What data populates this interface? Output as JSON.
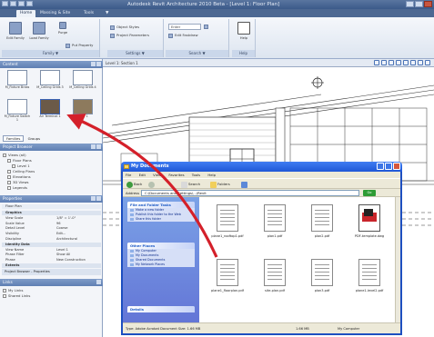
{
  "revit": {
    "title": "Autodesk Revit Architecture 2010 Beta - [Level 1: Floor Plan]",
    "tabs": [
      "Home",
      "Massing & Site",
      "Tools",
      "▼"
    ],
    "ribbon": {
      "panels": [
        {
          "label": "Family ▼",
          "buttons": [
            "Edit Family",
            "Load Family",
            "Purge"
          ],
          "small": [
            "Load Template",
            "Put Property"
          ]
        },
        {
          "label": "Settings ▼",
          "small": [
            "Object Styles",
            "Project Parameters"
          ]
        },
        {
          "label": "Search ▼",
          "input": "Enter",
          "small": [
            "Edit Fastdraw"
          ]
        },
        {
          "label": "Help",
          "buttons": [
            "Help"
          ]
        }
      ]
    },
    "library": {
      "header": "Content",
      "items": [
        {
          "label": "M_Fixture Brass",
          "selected": false
        },
        {
          "label": "M_Ceiling Grids 3",
          "selected": false
        },
        {
          "label": "M_Ceiling Grids 4",
          "selected": false
        },
        {
          "label": "M_Fixture Switch 1",
          "selected": false
        },
        {
          "label": "Air Terminal 1",
          "selected": true
        },
        {
          "label": "Floor 1",
          "selected": false
        }
      ],
      "tabs": [
        "Families",
        "Groups"
      ]
    },
    "browser": {
      "header": "Project Browser",
      "rows": [
        "Views (all)",
        "Floor Plans",
        "Level 1",
        "Ceiling Plans",
        "Elevations",
        "3D Views",
        "Legends"
      ]
    },
    "properties": {
      "header": "Properties",
      "subheader": "Floor Plan",
      "rows": [
        {
          "k": "Graphics",
          "v": "",
          "group": true
        },
        {
          "k": "View Scale",
          "v": "1/8\" = 1'-0\""
        },
        {
          "k": "Scale Value",
          "v": "96"
        },
        {
          "k": "Detail Level",
          "v": "Coarse"
        },
        {
          "k": "Visibility",
          "v": "Edit..."
        },
        {
          "k": "Discipline",
          "v": "Architectural"
        },
        {
          "k": "Identity Data",
          "v": "",
          "group": true
        },
        {
          "k": "View Name",
          "v": "Level 1"
        },
        {
          "k": "Phase Filter",
          "v": "Show All"
        },
        {
          "k": "Phase",
          "v": "New Construction"
        },
        {
          "k": "Extents",
          "v": "",
          "group": true
        }
      ],
      "footer": "Project Browser - Properties"
    },
    "bottom_panel": {
      "header": "Links",
      "rows": [
        "My Links",
        "Shared Links"
      ]
    },
    "canvas": {
      "tab": "Level 1: Section 1"
    }
  },
  "explorer": {
    "title": "My Documents",
    "menu": [
      "File",
      "Edit",
      "View",
      "Favorites",
      "Tools",
      "Help"
    ],
    "toolbar": [
      "Back",
      "Search",
      "Folders"
    ],
    "address_label": "Address",
    "address": "C:\\Documents and Settings\\...\\Revit",
    "go": "Go",
    "tasks": [
      {
        "header": "File and Folder Tasks",
        "items": [
          "Make a new folder",
          "Publish this folder to the Web",
          "Share this folder"
        ]
      },
      {
        "header": "Other Places",
        "items": [
          "My Computer",
          "My Documents",
          "Shared Documents",
          "My Network Places"
        ]
      },
      {
        "header": "Details",
        "items": []
      }
    ],
    "files": [
      {
        "name": "plane1_rooftop1.pdf",
        "kind": "doc"
      },
      {
        "name": "plan1.pdf",
        "kind": "doc"
      },
      {
        "name": "plan2.pdf",
        "kind": "doc"
      },
      {
        "name": "PDF-template.dwg",
        "kind": "red"
      },
      {
        "name": "plane1_floorplan.pdf",
        "kind": "doc"
      },
      {
        "name": "site-plan.pdf",
        "kind": "doc"
      },
      {
        "name": "plan3.pdf",
        "kind": "doc"
      },
      {
        "name": "plane1-level2.pdf",
        "kind": "doc"
      }
    ],
    "status": "Type: Adobe Acrobat Document Size: 1.66 MB",
    "status_size": "1.66 MB",
    "status_zone": "My Computer"
  }
}
